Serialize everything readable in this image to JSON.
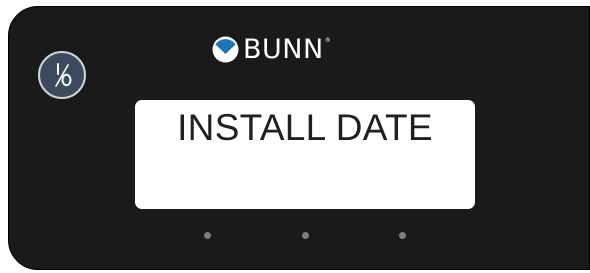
{
  "brand": {
    "name": "BUNN",
    "registered": "®",
    "mark_color": "#1b75bb"
  },
  "display": {
    "text": "INSTALL DATE"
  },
  "power_button": {
    "symbol": "I/O",
    "icon": "power-toggle-icon"
  },
  "nav_buttons": [
    {
      "name": "left-button"
    },
    {
      "name": "center-button"
    },
    {
      "name": "right-button"
    }
  ],
  "colors": {
    "panel": "#1a1a1a",
    "power_button": "#3b4a5c",
    "display_bg": "#ffffff",
    "dot": "#7a7f86"
  }
}
